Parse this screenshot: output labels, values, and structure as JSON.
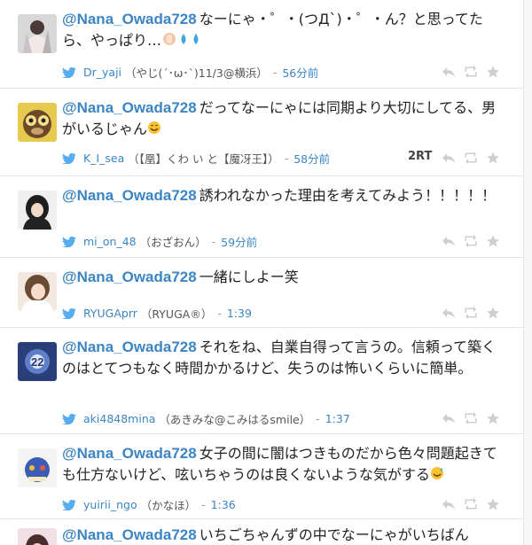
{
  "tweets": [
    {
      "mention": "@Nana_Owada728",
      "text": "なーにゃ・゜・(つД`)・゜・ん？と思ってたら、やっぱり…",
      "user": "Dr_yaji",
      "display_name": "（やじ(´･ω･`)11/3@横浜）",
      "time": "56分前",
      "rt": ""
    },
    {
      "mention": "@Nana_Owada728",
      "text": "だってなーにゃには同期より大切にしてる、男がいるじゃん",
      "user": "K_I_sea",
      "display_name": "（【凰】くわ い と【魔冴王】）",
      "time": "58分前",
      "rt": "2RT"
    },
    {
      "mention": "@Nana_Owada728",
      "text": "誘われなかった理由を考えてみよう！！！！！",
      "user": "mi_on_48",
      "display_name": "（おざおん）",
      "time": "59分前",
      "rt": ""
    },
    {
      "mention": "@Nana_Owada728",
      "text": "一緒にしよー笑",
      "user": "RYUGAprr",
      "display_name": "（RYUGA®）",
      "time": "1:39",
      "rt": ""
    },
    {
      "mention": "@Nana_Owada728",
      "text": "それをね、自業自得って言うの。信頼って築くのはとてつもなく時間かかるけど、失うのは怖いくらいに簡単。",
      "user": "aki4848mina",
      "display_name": "（あきみな@こみはるsmile）",
      "time": "1:37",
      "rt": ""
    },
    {
      "mention": "@Nana_Owada728",
      "text": "女子の間に闇はつきものだから色々問題起きても仕方ないけど、呟いちゃうのは良くないような気がする",
      "user": "yuirii_ngo",
      "display_name": "（かなほ）",
      "time": "1:36",
      "rt": ""
    },
    {
      "mention": "@Nana_Owada728",
      "text": "いちごちゃんずの中でなーにゃがいちばん",
      "user": "",
      "display_name": "",
      "time": "",
      "rt": ""
    }
  ],
  "colors": {
    "mention": "#3b85c4",
    "time": "#3b85c4",
    "bird": "#55acee"
  }
}
